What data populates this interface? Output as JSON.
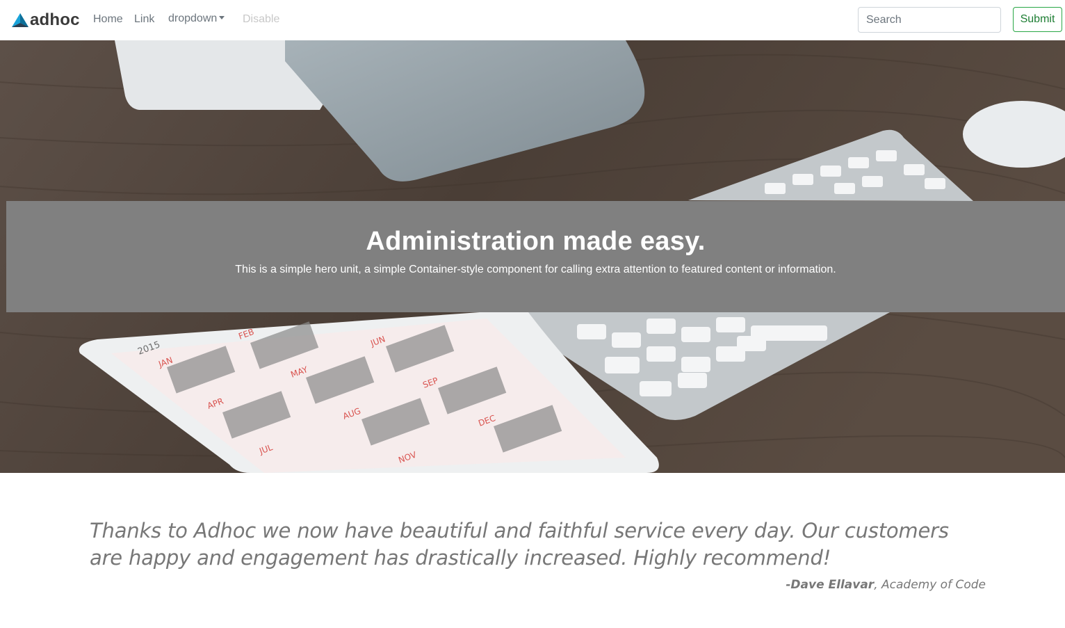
{
  "navbar": {
    "brand": "adhoc",
    "links": {
      "home": "Home",
      "link": "Link",
      "dropdown": "dropdown",
      "disabled": "Disable"
    },
    "search": {
      "placeholder": "Search",
      "value": ""
    },
    "submit_label": "Submit"
  },
  "hero": {
    "title": "Administration made easy.",
    "subtitle": "This is a simple hero unit, a simple Container-style component for calling extra attention to featured content or information."
  },
  "testimonial": {
    "quote": "Thanks to Adhoc we now have beautiful and faithful service every day. Our customers are happy and engagement has drastically increased. Highly recommend!",
    "author": "-Dave Ellavar",
    "separator": ", ",
    "organization": "Academy of Code"
  },
  "colors": {
    "accent_green": "#28a745",
    "brand_blue": "#1aa3d9",
    "hero_band": "#808080",
    "muted_text": "#777777"
  },
  "icons": {
    "brand_logo": "triangle-logo-icon",
    "dropdown_caret": "caret-down-icon"
  }
}
